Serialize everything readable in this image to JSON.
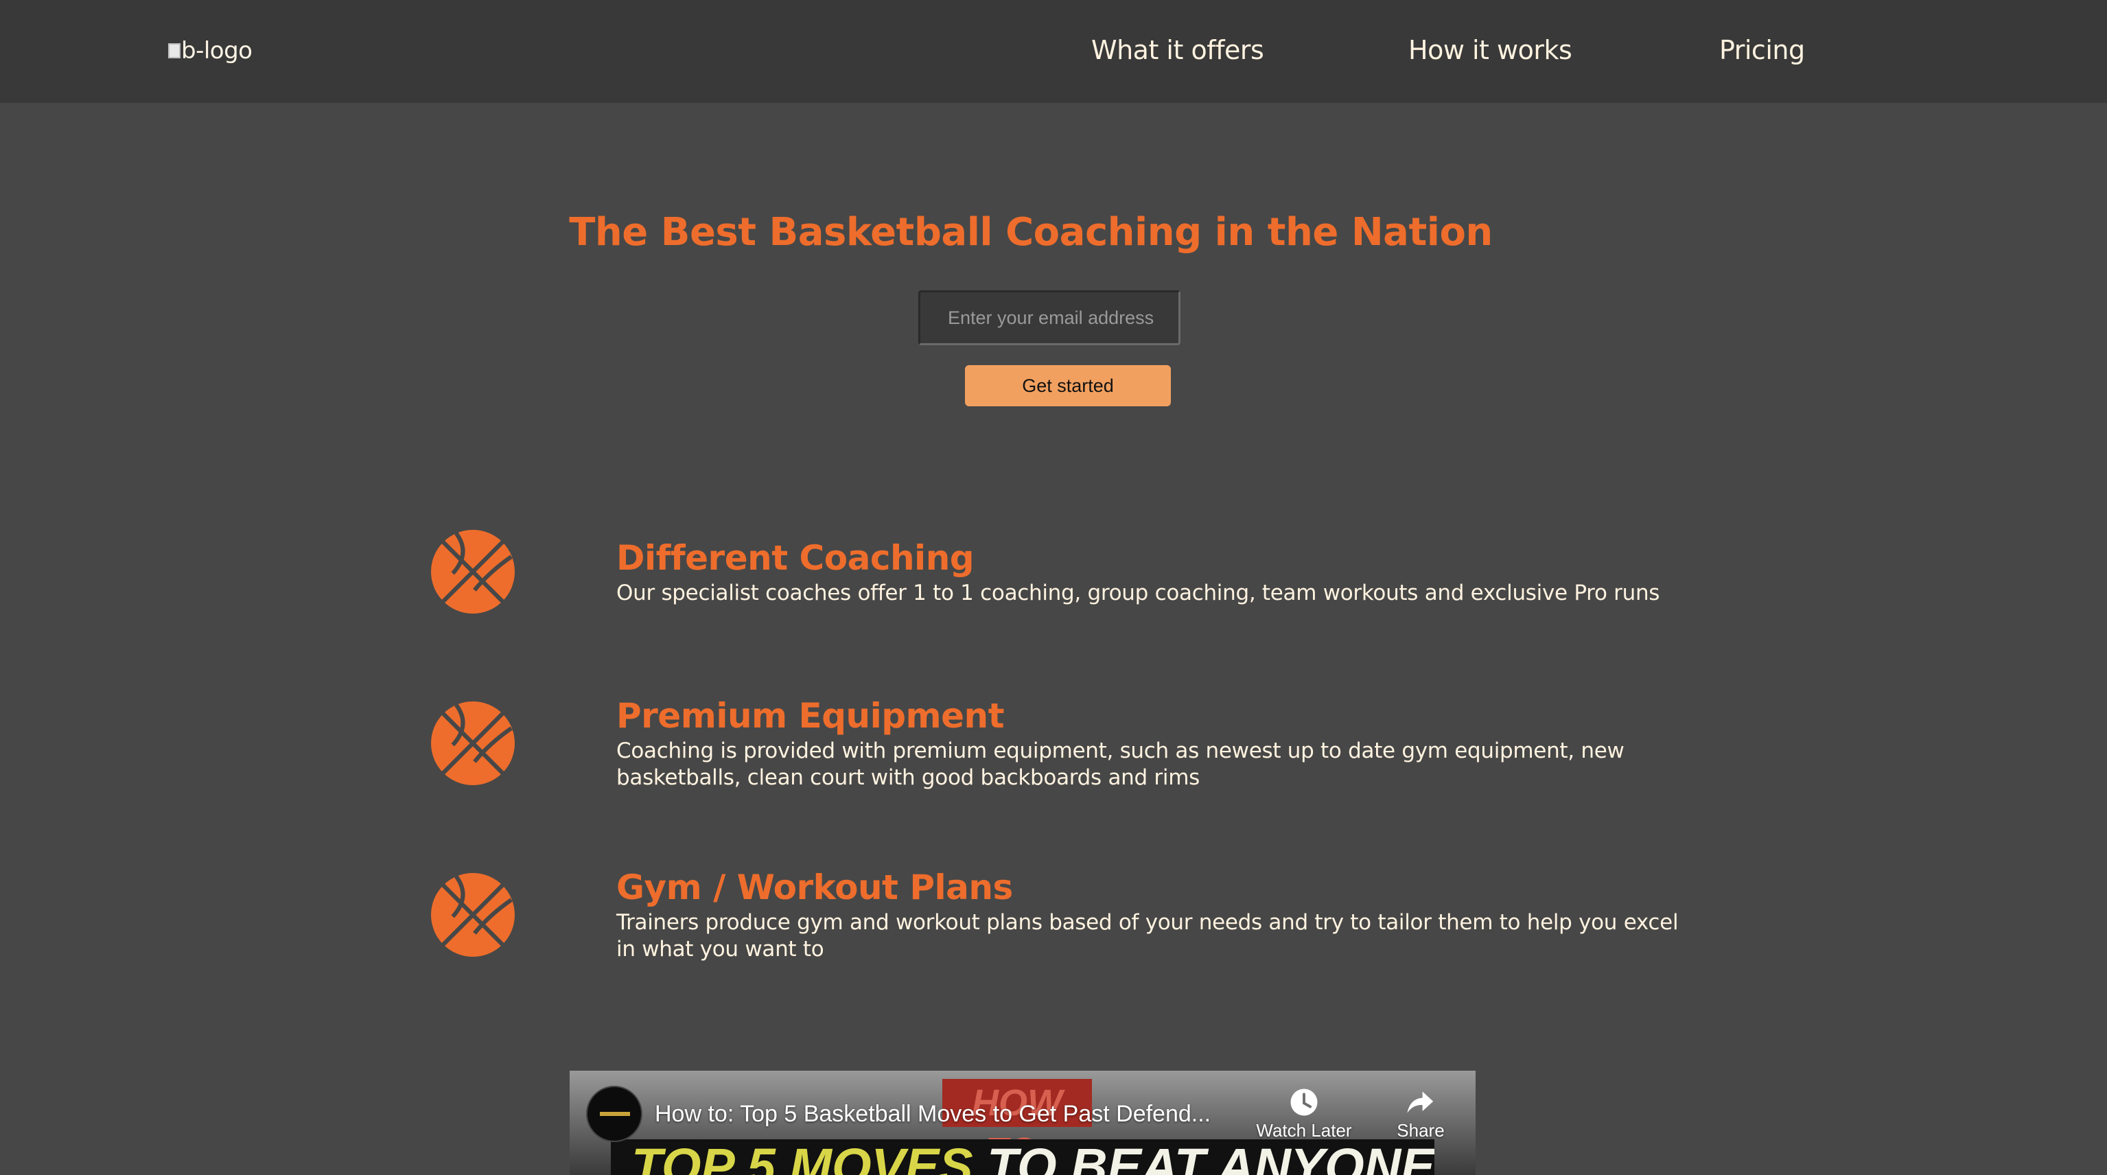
{
  "header": {
    "logo_alt": "b-logo",
    "nav": [
      {
        "label": "What it offers"
      },
      {
        "label": "How it works"
      },
      {
        "label": "Pricing"
      }
    ]
  },
  "hero": {
    "title": "The Best Basketball Coaching in the Nation",
    "email_placeholder": "Enter your email address",
    "button_label": "Get started"
  },
  "features": [
    {
      "icon": "basketball-icon",
      "title": "Different Coaching",
      "description": "Our specialist coaches offer 1 to 1 coaching, group coaching, team workouts and exclusive Pro runs"
    },
    {
      "icon": "basketball-icon",
      "title": "Premium Equipment",
      "description": "Coaching is provided with premium equipment, such as newest up to date gym equipment, new basketballs, clean court with good backboards and rims"
    },
    {
      "icon": "basketball-icon",
      "title": "Gym / Workout Plans",
      "description": "Trainers produce gym and workout plans based of your needs and try to tailor them to help you excel in what you want to"
    }
  ],
  "video": {
    "title": "How to: Top 5 Basketball Moves to Get Past Defend...",
    "watch_later_label": "Watch Later",
    "share_label": "Share",
    "thumb_banner": "HOW TO:",
    "thumb_text_highlight": "TOP 5 MOVES",
    "thumb_text_rest": " TO BEAT ANYONE!"
  },
  "colors": {
    "background": "#474747",
    "header": "#393939",
    "accent": "#ee6d2c",
    "button": "#f2a060",
    "text": "#fff3e0"
  }
}
